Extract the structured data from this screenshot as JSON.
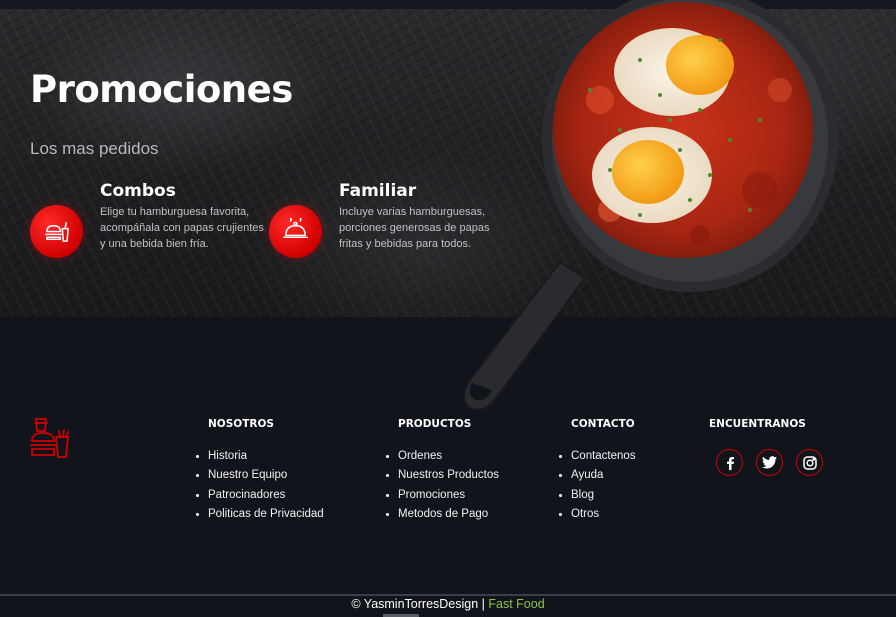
{
  "hero": {
    "title": "Promociones",
    "subtitle": "Los mas pedidos"
  },
  "promos": [
    {
      "title": "Combos",
      "description": "Elige tu hamburguesa favorita, acompáñala con papas crujientes y una bebida bien fría.",
      "icon": "fast-food-combo-icon"
    },
    {
      "title": "Familiar",
      "description": "Incluye varias hamburguesas, porciones generosas de papas fritas y bebidas para todos.",
      "icon": "food-tray-cloche-icon"
    }
  ],
  "footer": {
    "logo_icon": "fast-food-logo-icon",
    "columns": [
      {
        "heading": "NOSOTROS",
        "items": [
          "Historia",
          "Nuestro Equipo",
          "Patrocinadores",
          "Politicas de Privacidad"
        ]
      },
      {
        "heading": "PRODUCTOS",
        "items": [
          "Ordenes",
          "Nuestros Productos",
          "Promociones",
          "Metodos de Pago"
        ]
      },
      {
        "heading": "CONTACTO",
        "items": [
          "Contactenos",
          "Ayuda",
          "Blog",
          "Otros"
        ]
      }
    ],
    "social": {
      "heading": "ENCUENTRANOS",
      "icons": [
        "facebook-icon",
        "twitter-icon",
        "instagram-icon"
      ]
    }
  },
  "copyright": {
    "text": "© YasminTorresDesign |",
    "brand": "Fast Food"
  },
  "colors": {
    "accent_red": "#e00000",
    "brand_green": "#8bc34a",
    "background": "#11141a"
  }
}
